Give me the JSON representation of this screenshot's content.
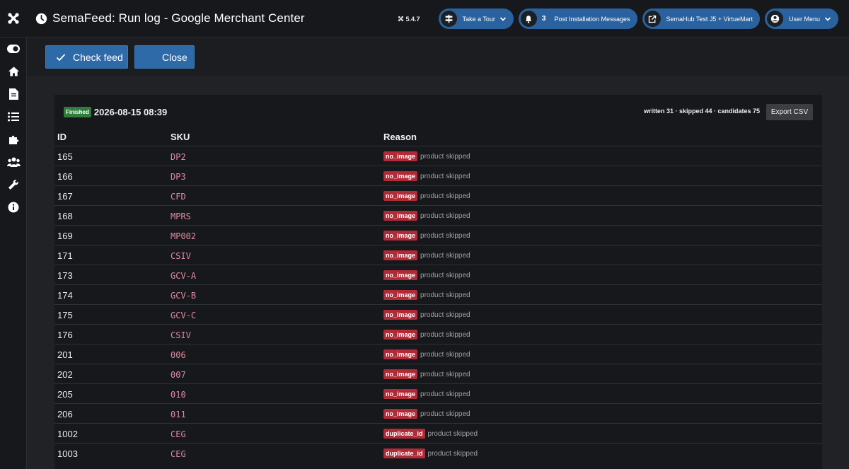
{
  "header": {
    "title": "SemaFeed: Run log - Google Merchant Center",
    "version": "5.4.7",
    "tour_label": "Take a Tour",
    "notifications_count": "3",
    "notifications_label": "Post Installation Messages",
    "site_label": "SemaHub Test J5 + VirtueMart",
    "user_menu_label": "User Menu"
  },
  "toolbar": {
    "check_label": "Check feed",
    "close_label": "Close"
  },
  "run": {
    "status": "Finished",
    "date": "2026-08-15 08:39",
    "stats": "written 31 · skipped 44 · candidates 75",
    "export_label": "Export CSV"
  },
  "table": {
    "headers": {
      "id": "ID",
      "sku": "SKU",
      "reason": "Reason"
    },
    "rows": [
      {
        "id": "165",
        "sku": "DP2",
        "reason": "no_image",
        "note": "product skipped"
      },
      {
        "id": "166",
        "sku": "DP3",
        "reason": "no_image",
        "note": "product skipped"
      },
      {
        "id": "167",
        "sku": "CFD",
        "reason": "no_image",
        "note": "product skipped"
      },
      {
        "id": "168",
        "sku": "MPRS",
        "reason": "no_image",
        "note": "product skipped"
      },
      {
        "id": "169",
        "sku": "MP002",
        "reason": "no_image",
        "note": "product skipped"
      },
      {
        "id": "171",
        "sku": "CSIV",
        "reason": "no_image",
        "note": "product skipped"
      },
      {
        "id": "173",
        "sku": "GCV-A",
        "reason": "no_image",
        "note": "product skipped"
      },
      {
        "id": "174",
        "sku": "GCV-B",
        "reason": "no_image",
        "note": "product skipped"
      },
      {
        "id": "175",
        "sku": "GCV-C",
        "reason": "no_image",
        "note": "product skipped"
      },
      {
        "id": "176",
        "sku": "CSIV",
        "reason": "no_image",
        "note": "product skipped"
      },
      {
        "id": "201",
        "sku": "006",
        "reason": "no_image",
        "note": "product skipped"
      },
      {
        "id": "202",
        "sku": "007",
        "reason": "no_image",
        "note": "product skipped"
      },
      {
        "id": "205",
        "sku": "010",
        "reason": "no_image",
        "note": "product skipped"
      },
      {
        "id": "206",
        "sku": "011",
        "reason": "no_image",
        "note": "product skipped"
      },
      {
        "id": "1002",
        "sku": "CEG",
        "reason": "duplicate_id",
        "note": "product skipped"
      },
      {
        "id": "1003",
        "sku": "CEG",
        "reason": "duplicate_id",
        "note": "product skipped"
      }
    ]
  },
  "sidebar": {
    "items": [
      "toggle-icon",
      "home-icon",
      "file-icon",
      "list-icon",
      "puzzle-icon",
      "users-icon",
      "wrench-icon",
      "info-icon"
    ]
  },
  "colors": {
    "primary_button": "#2e6aa7",
    "pill": "#2a62a0",
    "finished_badge": "#2f7d3b",
    "reason_badge": "#b02a37",
    "sku_text": "#e08aa0"
  }
}
